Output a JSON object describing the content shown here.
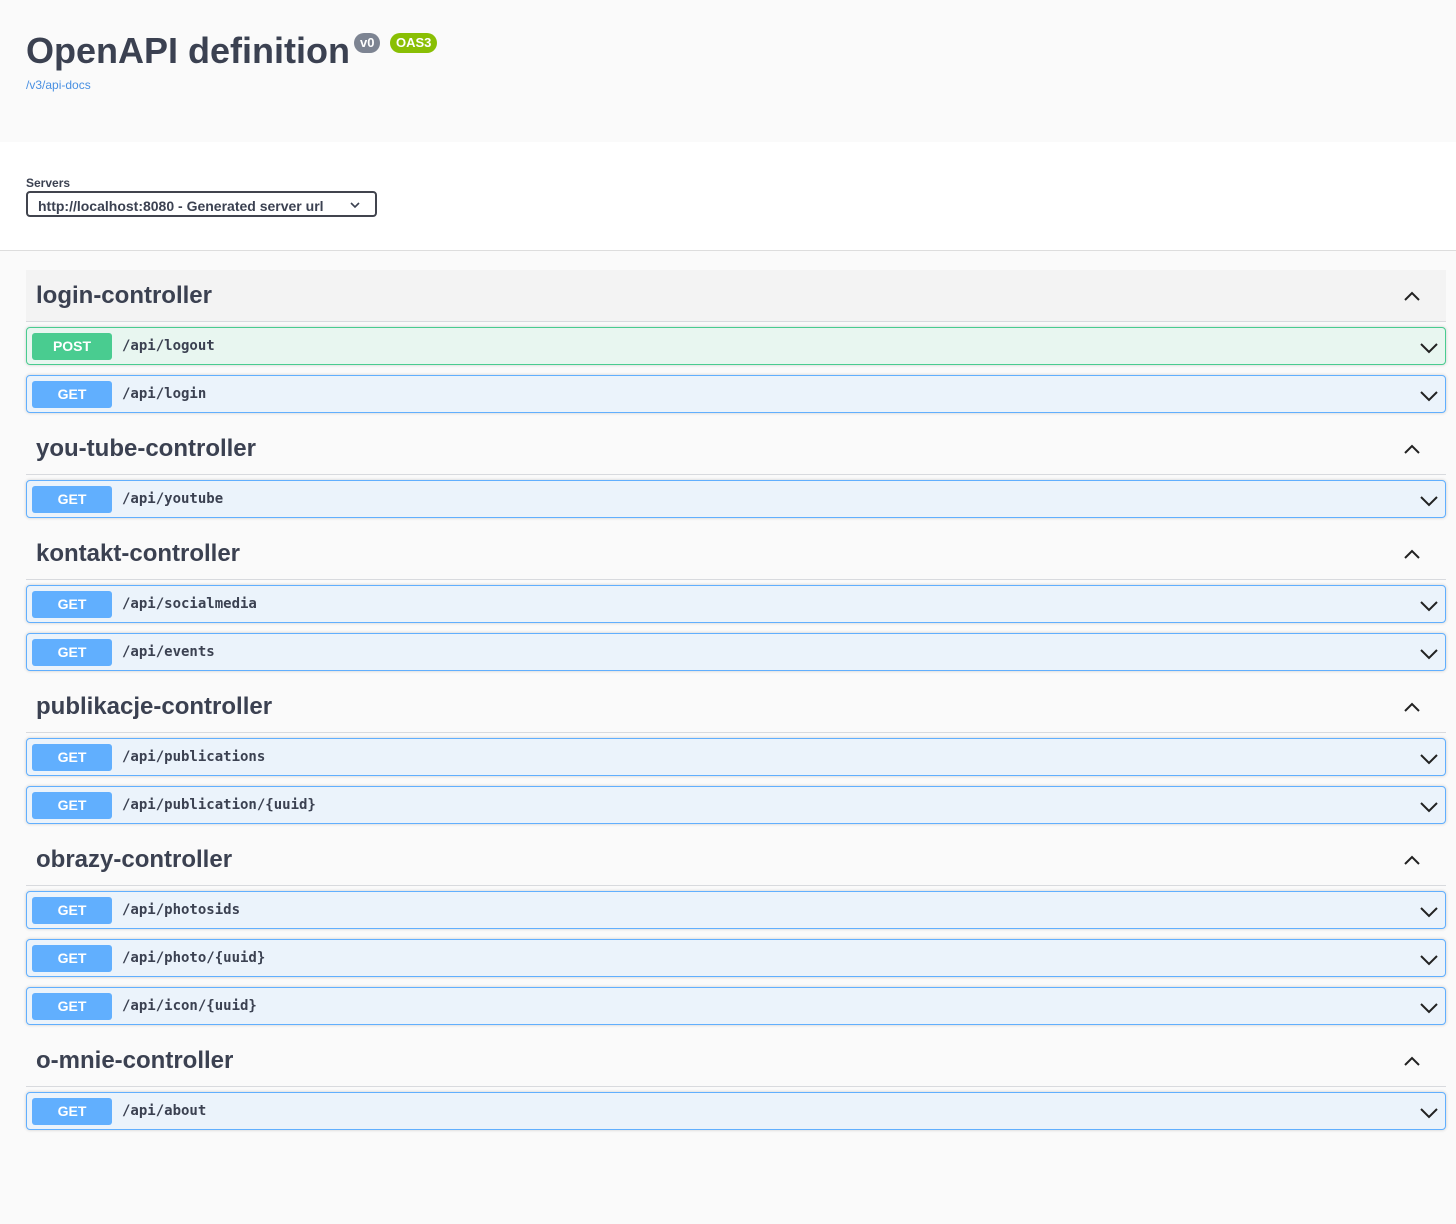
{
  "info": {
    "title": "OpenAPI definition",
    "version_badge": "v0",
    "oas_badge": "OAS3",
    "doc_link": "/v3/api-docs"
  },
  "servers": {
    "label": "Servers",
    "selected": "http://localhost:8080 - Generated server url"
  },
  "icons": {
    "tag_toggle": "chevron-up-icon",
    "operation_expand": "chevron-down-icon",
    "select_arrow": "chevron-down-icon"
  },
  "colors": {
    "get": "#61affe",
    "post": "#49cc90",
    "version_badge": "#7d8492",
    "oas_badge": "#89bf04",
    "link": "#4990e2"
  },
  "tags": [
    {
      "name": "login-controller",
      "operations": [
        {
          "method": "POST",
          "path": "/api/logout"
        },
        {
          "method": "GET",
          "path": "/api/login"
        }
      ]
    },
    {
      "name": "you-tube-controller",
      "operations": [
        {
          "method": "GET",
          "path": "/api/youtube"
        }
      ]
    },
    {
      "name": "kontakt-controller",
      "operations": [
        {
          "method": "GET",
          "path": "/api/socialmedia"
        },
        {
          "method": "GET",
          "path": "/api/events"
        }
      ]
    },
    {
      "name": "publikacje-controller",
      "operations": [
        {
          "method": "GET",
          "path": "/api/publications"
        },
        {
          "method": "GET",
          "path": "/api/publication/{uuid}"
        }
      ]
    },
    {
      "name": "obrazy-controller",
      "operations": [
        {
          "method": "GET",
          "path": "/api/photosids"
        },
        {
          "method": "GET",
          "path": "/api/photo/{uuid}"
        },
        {
          "method": "GET",
          "path": "/api/icon/{uuid}"
        }
      ]
    },
    {
      "name": "o-mnie-controller",
      "operations": [
        {
          "method": "GET",
          "path": "/api/about"
        }
      ]
    }
  ]
}
